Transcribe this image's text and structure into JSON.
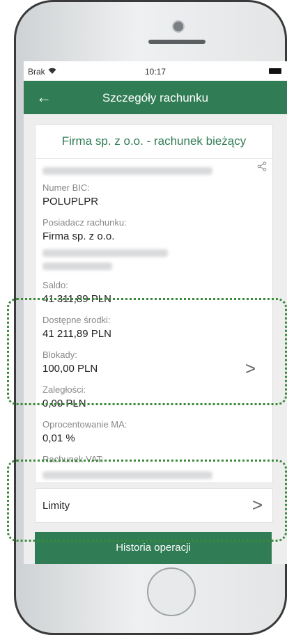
{
  "status_bar": {
    "carrier": "Brak",
    "wifi_icon": "wifi-icon",
    "time": "10:17",
    "battery_icon": "battery-icon"
  },
  "header": {
    "back_icon": "←",
    "title": "Szczegóły rachunku"
  },
  "account": {
    "name": "Firma sp. z o.o. - rachunek bieżący",
    "share_icon": "<",
    "fields": {
      "bic_label": "Numer BIC:",
      "bic_value": "POLUPLPR",
      "owner_label": "Posiadacz rachunku:",
      "owner_value": "Firma sp. z o.o.",
      "balance_label": "Saldo:",
      "balance_value": "41 311,89 PLN",
      "available_label": "Dostępne środki:",
      "available_value": "41 211,89 PLN",
      "blocks_label": "Blokady:",
      "blocks_value": "100,00 PLN",
      "arrears_label": "Zaległości:",
      "arrears_value": "0,00 PLN",
      "interest_label": "Oprocentowanie MA:",
      "interest_value": "0,01 %",
      "vat_label": "Rachunek VAT:"
    }
  },
  "limits": {
    "label": "Limity",
    "chevron": ">"
  },
  "history_button": {
    "label": "Historia operacji"
  },
  "colors": {
    "brand": "#2f7c55",
    "highlight": "#3b8a3b"
  }
}
